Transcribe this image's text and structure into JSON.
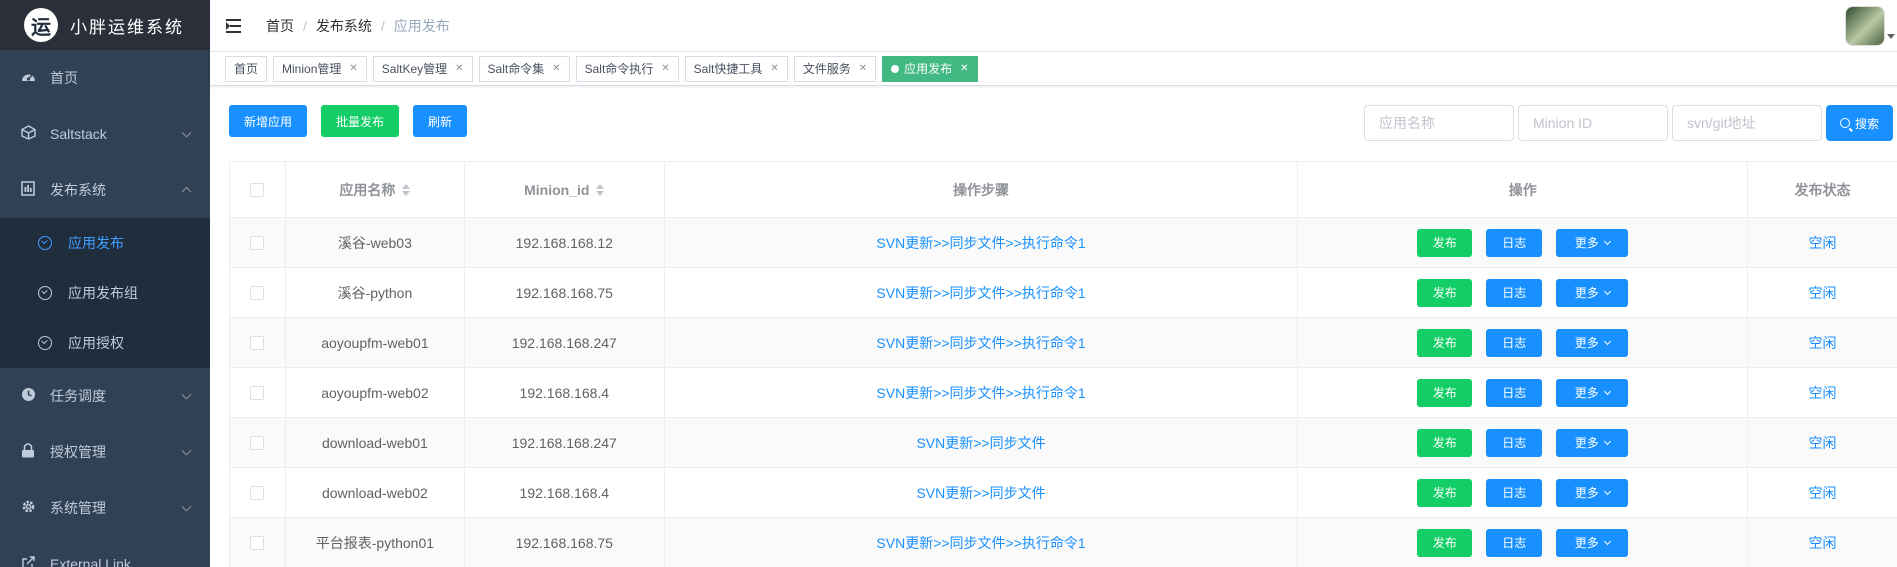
{
  "app": {
    "logo_char": "运",
    "title": "小胖运维系统"
  },
  "sidebar": {
    "items": [
      {
        "label": "首页",
        "icon": "dashboard-icon"
      },
      {
        "label": "Saltstack",
        "icon": "cube-icon"
      },
      {
        "label": "发布系统",
        "icon": "release-icon",
        "expanded": true,
        "children": [
          {
            "label": "应用发布",
            "active": true
          },
          {
            "label": "应用发布组"
          },
          {
            "label": "应用授权"
          }
        ]
      },
      {
        "label": "任务调度",
        "icon": "clock-icon"
      },
      {
        "label": "授权管理",
        "icon": "lock-icon"
      },
      {
        "label": "系统管理",
        "icon": "gear-icon"
      },
      {
        "label": "External Link",
        "icon": "link-icon"
      }
    ]
  },
  "breadcrumb": [
    "首页",
    "发布系统",
    "应用发布"
  ],
  "tabs": [
    {
      "label": "首页"
    },
    {
      "label": "Minion管理"
    },
    {
      "label": "SaltKey管理"
    },
    {
      "label": "Salt命令集"
    },
    {
      "label": "Salt命令执行"
    },
    {
      "label": "Salt快捷工具"
    },
    {
      "label": "文件服务"
    },
    {
      "label": "应用发布",
      "active": true
    }
  ],
  "toolbar": {
    "add": "新增应用",
    "batch": "批量发布",
    "refresh": "刷新"
  },
  "search": {
    "app_placeholder": "应用名称",
    "minion_placeholder": "Minion ID",
    "repo_placeholder": "svn/git地址",
    "button": "搜索"
  },
  "table": {
    "headers": {
      "name": "应用名称",
      "minion": "Minion_id",
      "steps": "操作步骤",
      "ops": "操作",
      "status": "发布状态"
    },
    "op_labels": {
      "publish": "发布",
      "log": "日志",
      "more": "更多"
    },
    "rows": [
      {
        "name": "溪谷-web03",
        "minion": "192.168.168.12",
        "steps": "SVN更新>>同步文件>>执行命令1",
        "status": "空闲"
      },
      {
        "name": "溪谷-python",
        "minion": "192.168.168.75",
        "steps": "SVN更新>>同步文件>>执行命令1",
        "status": "空闲"
      },
      {
        "name": "aoyoupfm-web01",
        "minion": "192.168.168.247",
        "steps": "SVN更新>>同步文件>>执行命令1",
        "status": "空闲"
      },
      {
        "name": "aoyoupfm-web02",
        "minion": "192.168.168.4",
        "steps": "SVN更新>>同步文件>>执行命令1",
        "status": "空闲"
      },
      {
        "name": "download-web01",
        "minion": "192.168.168.247",
        "steps": "SVN更新>>同步文件",
        "status": "空闲"
      },
      {
        "name": "download-web02",
        "minion": "192.168.168.4",
        "steps": "SVN更新>>同步文件",
        "status": "空闲"
      },
      {
        "name": "平台报表-python01",
        "minion": "192.168.168.75",
        "steps": "SVN更新>>同步文件>>执行命令1",
        "status": "空闲"
      }
    ]
  },
  "colors": {
    "sidebar_bg": "#304156",
    "primary": "#1890ff",
    "success": "#13ce66",
    "tag_active": "#42b983"
  }
}
